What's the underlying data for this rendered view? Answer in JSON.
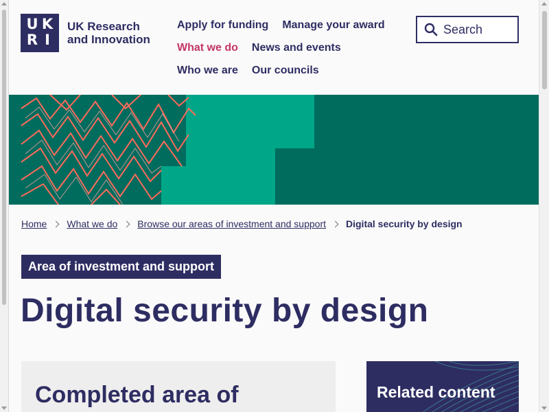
{
  "header": {
    "logo_letters": [
      "U",
      "K",
      "R",
      "I"
    ],
    "logo_line1": "UK Research",
    "logo_line2": "and Innovation",
    "nav": [
      {
        "label": "Apply for funding",
        "active": false
      },
      {
        "label": "Manage your award",
        "active": false
      },
      {
        "label": "What we do",
        "active": true
      },
      {
        "label": "News and events",
        "active": false
      },
      {
        "label": "Who we are",
        "active": false
      },
      {
        "label": "Our councils",
        "active": false
      }
    ],
    "search_label": "Search"
  },
  "breadcrumb": {
    "home": "Home",
    "what_we_do": "What we do",
    "browse": "Browse our areas of investment and support",
    "current": "Digital security by design"
  },
  "main": {
    "tag": "Area of investment and support",
    "title": "Digital security by design",
    "completed_heading": "Completed area of",
    "related_heading": "Related content"
  },
  "colors": {
    "brand_navy": "#2e2d62",
    "nav_active": "#c43468",
    "banner_dark_green": "#006c5e",
    "banner_light_green": "#00a688",
    "banner_coral": "#ff6a5a"
  }
}
